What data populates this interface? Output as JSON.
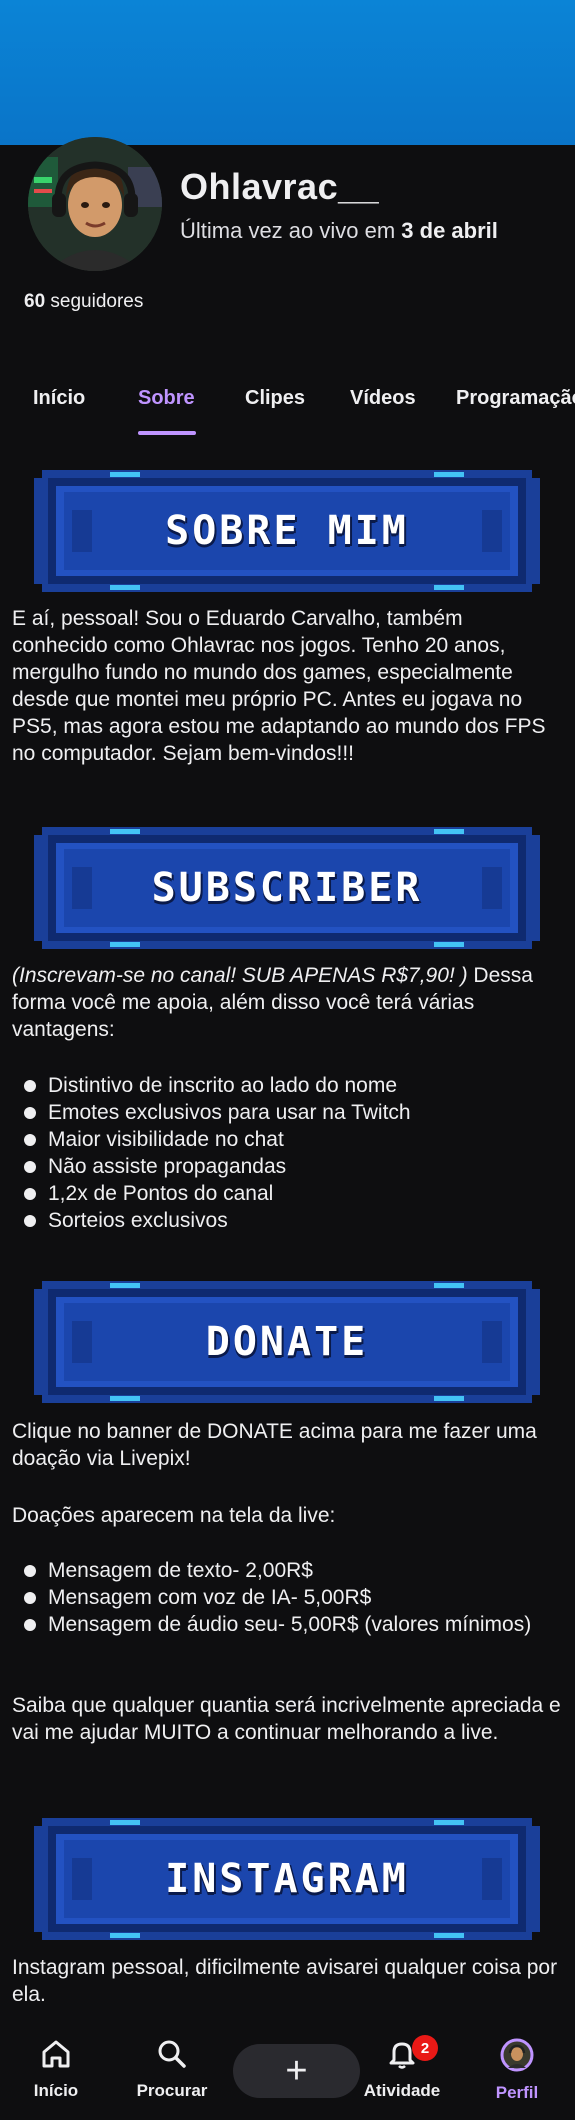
{
  "channel": {
    "name": "Ohlavrac__",
    "last_live_prefix": "Última vez ao vivo em ",
    "last_live_date": "3 de abril",
    "followers_count": "60",
    "followers_label": " seguidores"
  },
  "tabs": [
    {
      "label": "Início",
      "active": false
    },
    {
      "label": "Sobre",
      "active": true
    },
    {
      "label": "Clipes",
      "active": false
    },
    {
      "label": "Vídeos",
      "active": false
    },
    {
      "label": "Programação",
      "active": false
    }
  ],
  "panels": {
    "sobre": {
      "banner": "SOBRE MIM",
      "text": "E aí, pessoal! Sou o Eduardo Carvalho, também conhecido como Ohlavrac nos jogos. Tenho 20 anos, mergulho fundo no mundo dos games, especialmente desde que montei meu próprio PC. Antes eu jogava no PS5, mas agora estou me adaptando ao mundo dos FPS no computador. Sejam bem-vindos!!!"
    },
    "subscriber": {
      "banner": "SUBSCRIBER",
      "intro_italic": "(Inscrevam-se no canal! SUB APENAS R$7,90! )",
      "intro_rest": " Dessa forma você me apoia, além disso você terá várias vantagens:",
      "benefits": [
        "Distintivo de inscrito ao lado do nome",
        "Emotes exclusivos para usar na Twitch",
        "Maior visibilidade no chat",
        "Não assiste propagandas",
        "1,2x de Pontos do canal",
        "Sorteios exclusivos"
      ]
    },
    "donate": {
      "banner": "DONATE",
      "text1": "Clique no banner de DONATE acima para me fazer uma doação via Livepix!",
      "text2": "Doações aparecem na tela da live:",
      "items": [
        "Mensagem de texto- 2,00R$",
        "Mensagem com voz de IA- 5,00R$",
        "Mensagem de áudio seu- 5,00R$ (valores mínimos)"
      ],
      "text3": "Saiba que qualquer quantia será incrivelmente apreciada e vai me ajudar MUITO a continuar melhorando a live."
    },
    "instagram": {
      "banner": "INSTAGRAM",
      "text": "Instagram pessoal, dificilmente avisarei qualquer coisa por ela."
    }
  },
  "bottom_nav": {
    "home": "Início",
    "search": "Procurar",
    "create": "+",
    "activity": "Atividade",
    "activity_badge": "2",
    "profile": "Perfil"
  },
  "colors": {
    "background": "#0e0e10",
    "accent": "#bf94ff",
    "banner_blue": "#0a74c8",
    "panel_blue": "#1f4fb5",
    "badge_red": "#e91916"
  }
}
